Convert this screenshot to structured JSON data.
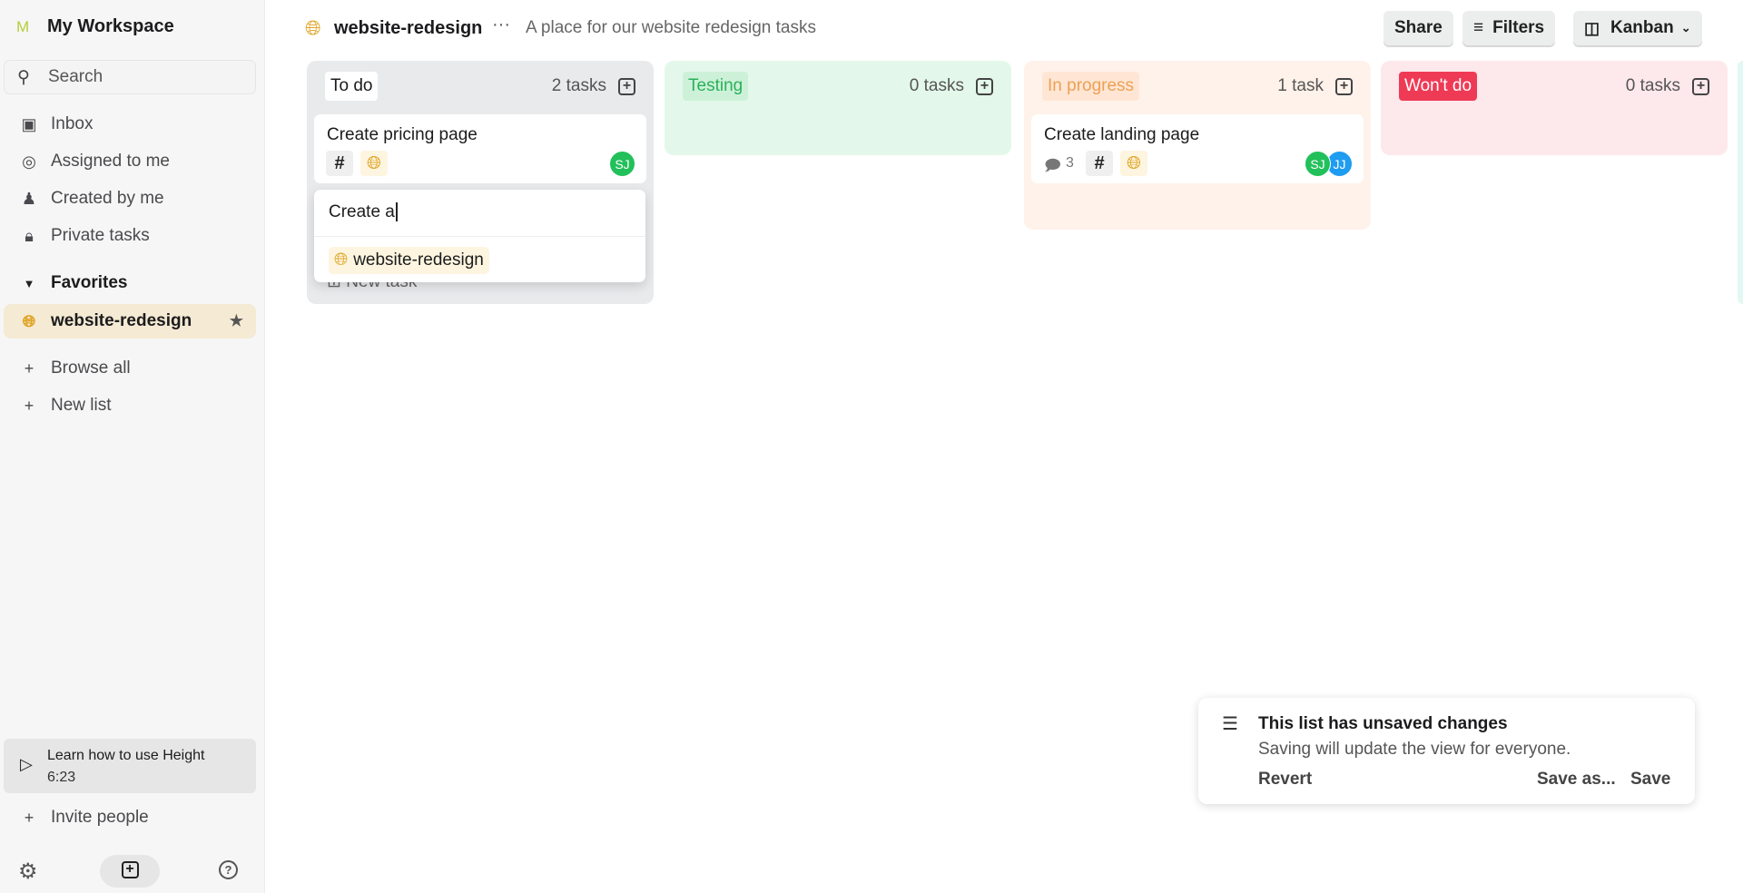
{
  "sidebar": {
    "workspace_initial": "M",
    "workspace_name": "My Workspace",
    "search_placeholder": "Search",
    "nav": [
      {
        "label": "Inbox",
        "icon": "inbox-icon"
      },
      {
        "label": "Assigned to me",
        "icon": "target-icon"
      },
      {
        "label": "Created by me",
        "icon": "user-icon"
      },
      {
        "label": "Private tasks",
        "icon": "lock-icon"
      }
    ],
    "favorites_label": "Favorites",
    "favorite_item": "website-redesign",
    "browse_all": "Browse all",
    "new_list": "New list",
    "learn_title": "Learn how to use Height",
    "learn_duration": "6:23",
    "invite": "Invite people"
  },
  "header": {
    "list_name": "website-redesign",
    "description": "A place for our website redesign tasks",
    "share": "Share",
    "filters": "Filters",
    "view": "Kanban"
  },
  "columns": [
    {
      "label": "To do",
      "count": "2 tasks",
      "color": "#e9eaec"
    },
    {
      "label": "Testing",
      "count": "0 tasks",
      "color": "#e3f8ea"
    },
    {
      "label": "In progress",
      "count": "1 task",
      "color": "#fff2ea"
    },
    {
      "label": "Won't do",
      "count": "0 tasks",
      "color": "#fde8eb"
    }
  ],
  "cards": {
    "pricing": {
      "title": "Create pricing page",
      "assignees": [
        "SJ"
      ]
    },
    "landing": {
      "title": "Create landing page",
      "comments": "3",
      "assignees": [
        "SJ",
        "JJ"
      ]
    }
  },
  "new_task": {
    "input_value": "Create a",
    "suggestion": "website-redesign",
    "new_task_label": "New task"
  },
  "toast": {
    "title": "This list has unsaved changes",
    "message": "Saving will update the view for everyone.",
    "revert": "Revert",
    "save_as": "Save as...",
    "save": "Save"
  },
  "colors": {
    "accent_green": "#22c05a",
    "accent_blue": "#1e9cf0",
    "wont_do_red": "#ef3a56",
    "globe_gold": "#e0a323"
  }
}
